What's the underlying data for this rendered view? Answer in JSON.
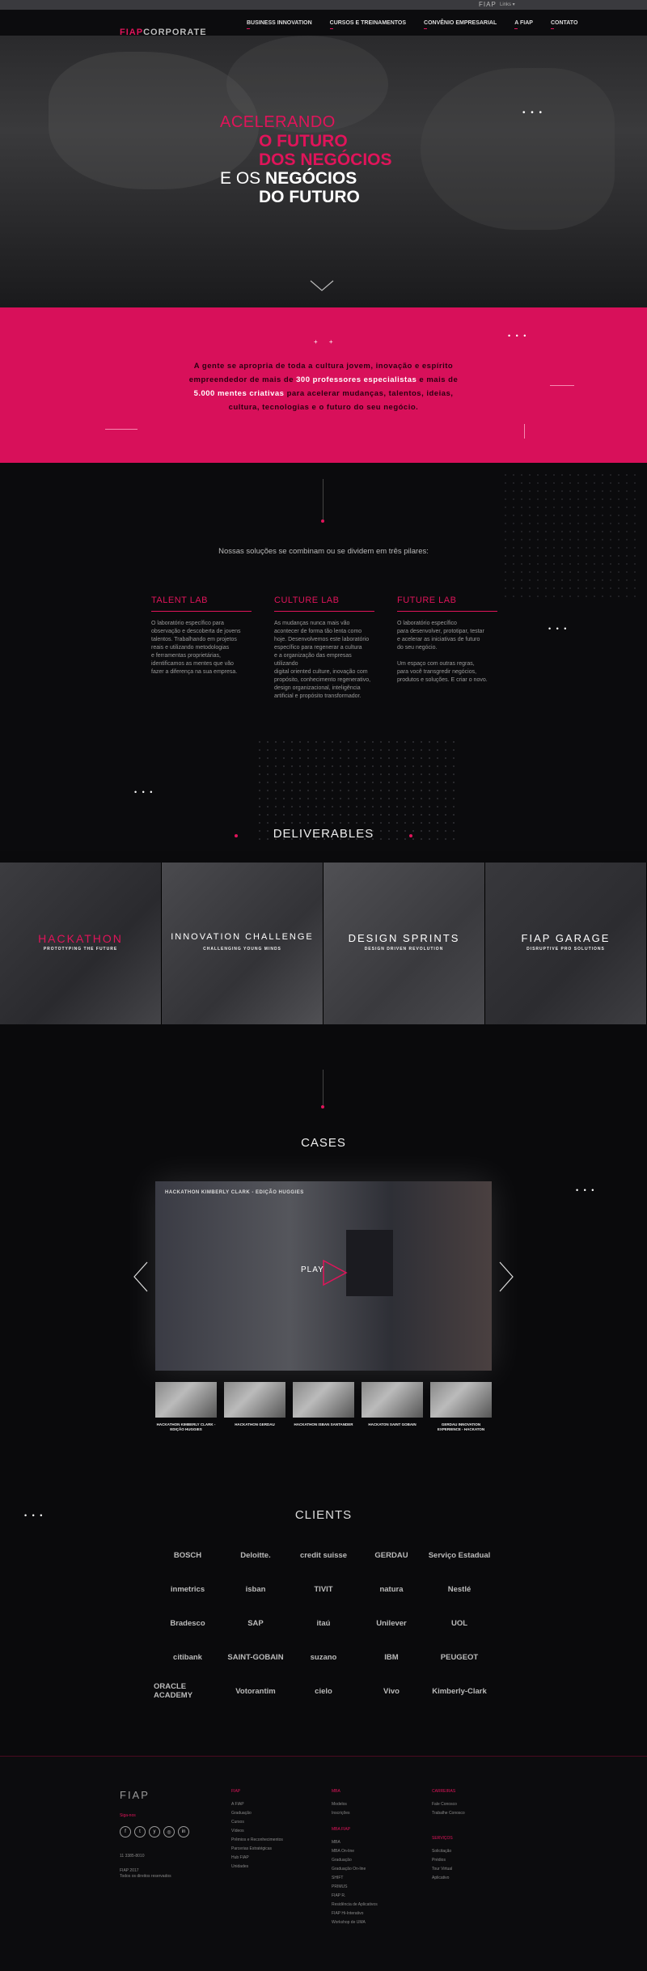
{
  "topbar": {
    "logo": "FIAP",
    "lang": "Links ▾"
  },
  "nav": {
    "logo_fiap": "FIAP",
    "logo_corporate": "CORPORATE",
    "items": [
      "BUSINESS INNOVATION",
      "CURSOS E TREINAMENTOS",
      "CONVÊNIO EMPRESARIAL",
      "A FIAP",
      "CONTATO"
    ]
  },
  "hero": {
    "line1": "ACELERANDO",
    "line2": "O FUTURO",
    "line3": "DOS NEGÓCIOS",
    "line4_a": "E OS ",
    "line4_b": "NEGÓCIOS",
    "line5": "DO FUTURO",
    "dots": "• • •"
  },
  "manifesto": {
    "part1": "A gente se apropria de toda a cultura jovem, inovação e espírito empreendedor de mais de ",
    "hl1": "300 professores especialistas",
    "part2": " e mais de ",
    "hl2": "5.000 mentes criativas",
    "part3": " para acelerar mudanças, talentos, ideias, cultura, tecnologias e o futuro do seu negócio.",
    "dots": "• • •",
    "plus": "+ +"
  },
  "pillars": {
    "intro": "Nossas soluções se combinam ou se dividem em três pilares:",
    "dots": "• • •",
    "cols": [
      {
        "title": "TALENT LAB",
        "text": "O laboratório específico para\nobservação e descoberta de jovens\ntalentos. Trabalhando em projetos\nreais e utilizando metodologias\ne ferramentas proprietárias,\nidentificamos as mentes que vão\nfazer a diferença na sua empresa."
      },
      {
        "title": "CULTURE LAB",
        "text": "As mudanças nunca mais vão\nacontecer de forma tão lenta como\nhoje. Desenvolvemos este laboratório\nespecífico para regenerar a cultura\ne a organização das empresas utilizando\ndigital oriented culture, inovação com\npropósito, conhecimento regenerativo,\ndesign organizacional, inteligência\nartificial e propósito transformador."
      },
      {
        "title": "FUTURE LAB",
        "text": "O laboratório específico\npara desenvolver, prototipar, testar\ne acelerar as iniciativas de futuro\ndo seu negócio.\n\nUm espaço com outras regras,\npara você transgredir negócios,\nprodutos e soluções. E criar o novo."
      }
    ]
  },
  "deliverables": {
    "title": "DELIVERABLES",
    "cards": [
      {
        "title": "HACKATHON",
        "sub": "PROTOTYPING THE FUTURE",
        "color": "#e0145a"
      },
      {
        "title": "INNOVATION CHALLENGE",
        "sub": "CHALLENGING YOUNG MINDS",
        "color": "#ffffff"
      },
      {
        "title": "DESIGN SPRINTS",
        "sub": "DESIGN DRIVEN REVOLUTION",
        "color": "#ffffff"
      },
      {
        "title": "FIAP GARAGE",
        "sub": "DISRUPTIVE PRO SOLUTIONS",
        "color": "#ffffff"
      }
    ]
  },
  "cases": {
    "title": "CASES",
    "video_caption": "HACKATHON KIMBERLY CLARK - EDIÇÃO HUGGIES",
    "play": "PLAY",
    "dots": "• • •",
    "thumbs": [
      "HACKATHON KIMBERLY CLARK - EDIÇÃO HUGGIES",
      "HACKATHON GERDAU",
      "HACKATHON ISBAN SANTANDER",
      "HACKATON SAINT GOBAIN",
      "GERDAU INNOVATION EXPERIENCE - HACKATON"
    ]
  },
  "clients": {
    "title": "CLIENTS",
    "dots": "• • •",
    "logos": [
      "BOSCH",
      "Deloitte.",
      "credit suisse",
      "GERDAU",
      "Serviço Estadual",
      "inmetrics",
      "isban",
      "TIVIT",
      "natura",
      "Nestlé",
      "Bradesco",
      "SAP",
      "itaú",
      "Unilever",
      "UOL",
      "citibank",
      "SAINT-GOBAIN",
      "suzano",
      "IBM",
      "PEUGEOT",
      "ORACLE ACADEMY",
      "Votorantim",
      "cielo",
      "Vivo",
      "Kimberly-Clark"
    ]
  },
  "footer": {
    "logo": "FIAP",
    "siga": "Siga-nos",
    "social": [
      "f",
      "t",
      "y",
      "◎",
      "in"
    ],
    "phone": "11 3385-8010",
    "copy1": "FIAP 2017",
    "copy2": "Todos os direitos reservados",
    "cols": [
      {
        "title": "FIAP",
        "items": [
          "A FIAP",
          "Graduação",
          "Cursos",
          "Vídeos",
          "Prêmios e Reconhecimentos",
          "Parcerias Estratégicas",
          "Hub FIAP",
          "Unidades"
        ]
      },
      {
        "title": "MBA",
        "items": [
          "Modelos",
          "Inscrições",
          "",
          "MBA FIAP",
          "MBA",
          "MBA On-line",
          "Graduação",
          "Graduação On-line",
          "SHIFT",
          "PRIMUS",
          "FIAP R.",
          "Residência de Aplicativos",
          "FIAP Hi-Interativo",
          "Workshop de UMA"
        ]
      },
      {
        "title": "CARREIRAS",
        "items": [
          "Fale Conosco",
          "Trabalhe Conosco",
          "",
          "",
          "SERVIÇOS",
          "Solicitação",
          "Prédios",
          "Tour Virtual",
          "Aplicativo"
        ]
      }
    ]
  }
}
